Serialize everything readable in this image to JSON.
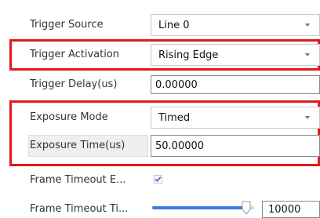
{
  "rows": {
    "trigger_source": {
      "label": "Trigger Source",
      "value": "Line 0"
    },
    "trigger_activation": {
      "label": "Trigger Activation",
      "value": "Rising Edge"
    },
    "trigger_delay": {
      "label": "Trigger Delay(us)",
      "value": "0.00000"
    },
    "exposure_mode": {
      "label": "Exposure Mode",
      "value": "Timed"
    },
    "exposure_time": {
      "label": "Exposure Time(us)",
      "value": "50.00000"
    },
    "frame_timeout_enable": {
      "label": "Frame Timeout E...",
      "checked": true
    },
    "frame_timeout_time": {
      "label": "Frame Timeout Ti...",
      "value": "10000",
      "slider_level": 0.92
    }
  },
  "colors": {
    "highlight": "#e0191f",
    "accent": "#3f79e6"
  },
  "icons": {
    "dropdown": "chevron-down-icon",
    "checkbox": "checkmark-icon",
    "slider": "slider-thumb-icon"
  }
}
